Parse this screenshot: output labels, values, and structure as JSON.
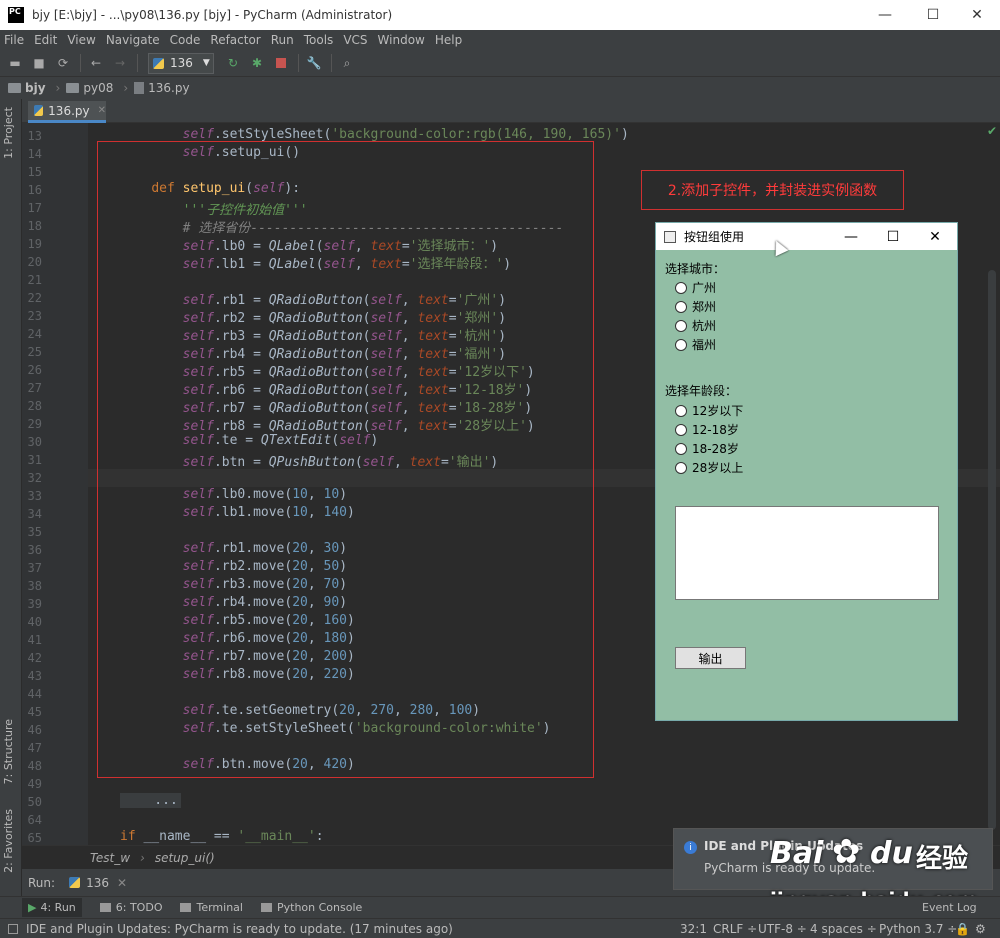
{
  "window": {
    "title": "bjy [E:\\bjy] - ...\\py08\\136.py [bjy] - PyCharm (Administrator)",
    "logo": "PC"
  },
  "menu": [
    "File",
    "Edit",
    "View",
    "Navigate",
    "Code",
    "Refactor",
    "Run",
    "Tools",
    "VCS",
    "Window",
    "Help"
  ],
  "toolbar": {
    "run_config": "136"
  },
  "nav": {
    "project": "bjy",
    "folder": "py08",
    "file": "136.py"
  },
  "left_tools": [
    "1: Project",
    "7: Structure",
    "2: Favorites"
  ],
  "tab": {
    "label": "136.py"
  },
  "code": [
    {
      "n": "13",
      "t": "        <s>self</s>.setStyleSheet(<g>'background-color:rgb(146, 190, 165)'</g>)"
    },
    {
      "n": "14",
      "t": "        <s>self</s>.setup_ui()"
    },
    {
      "n": "15",
      "t": ""
    },
    {
      "n": "16",
      "t": "    <k>def</k> <f>setup_ui</f>(<s>self</s>):"
    },
    {
      "n": "17",
      "t": "        <c>'''子控件初始值'''</c>"
    },
    {
      "n": "18",
      "t": "        <m># 选择省份----------------------------------------</m>"
    },
    {
      "n": "19",
      "t": "        <s>self</s>.lb0 = <i>QLabel</i>(<s>self</s>, <p>text</p>=<g>'选择城市：'</g>)"
    },
    {
      "n": "20",
      "t": "        <s>self</s>.lb1 = <i>QLabel</i>(<s>self</s>, <p>text</p>=<g>'选择年龄段：'</g>)"
    },
    {
      "n": "21",
      "t": ""
    },
    {
      "n": "22",
      "t": "        <s>self</s>.rb1 = <i>QRadioButton</i>(<s>self</s>, <p>text</p>=<g>'广州'</g>)"
    },
    {
      "n": "23",
      "t": "        <s>self</s>.rb2 = <i>QRadioButton</i>(<s>self</s>, <p>text</p>=<g>'郑州'</g>)"
    },
    {
      "n": "24",
      "t": "        <s>self</s>.rb3 = <i>QRadioButton</i>(<s>self</s>, <p>text</p>=<g>'杭州'</g>)"
    },
    {
      "n": "25",
      "t": "        <s>self</s>.rb4 = <i>QRadioButton</i>(<s>self</s>, <p>text</p>=<g>'福州'</g>)"
    },
    {
      "n": "26",
      "t": "        <s>self</s>.rb5 = <i>QRadioButton</i>(<s>self</s>, <p>text</p>=<g>'12岁以下'</g>)"
    },
    {
      "n": "27",
      "t": "        <s>self</s>.rb6 = <i>QRadioButton</i>(<s>self</s>, <p>text</p>=<g>'12-18岁'</g>)"
    },
    {
      "n": "28",
      "t": "        <s>self</s>.rb7 = <i>QRadioButton</i>(<s>self</s>, <p>text</p>=<g>'18-28岁'</g>)"
    },
    {
      "n": "29",
      "t": "        <s>self</s>.rb8 = <i>QRadioButton</i>(<s>self</s>, <p>text</p>=<g>'28岁以上'</g>)"
    },
    {
      "n": "30",
      "t": "        <s>self</s>.te = <i>QTextEdit</i>(<s>self</s>)"
    },
    {
      "n": "31",
      "t": "        <s>self</s>.btn = <i>QPushButton</i>(<s>self</s>, <p>text</p>=<g>'输出'</g>)"
    },
    {
      "n": "32",
      "t": ""
    },
    {
      "n": "33",
      "t": "        <s>self</s>.lb0.move(<u>10</u>, <u>10</u>)"
    },
    {
      "n": "34",
      "t": "        <s>self</s>.lb1.move(<u>10</u>, <u>140</u>)"
    },
    {
      "n": "35",
      "t": ""
    },
    {
      "n": "36",
      "t": "        <s>self</s>.rb1.move(<u>20</u>, <u>30</u>)"
    },
    {
      "n": "37",
      "t": "        <s>self</s>.rb2.move(<u>20</u>, <u>50</u>)"
    },
    {
      "n": "38",
      "t": "        <s>self</s>.rb3.move(<u>20</u>, <u>70</u>)"
    },
    {
      "n": "39",
      "t": "        <s>self</s>.rb4.move(<u>20</u>, <u>90</u>)"
    },
    {
      "n": "40",
      "t": "        <s>self</s>.rb5.move(<u>20</u>, <u>160</u>)"
    },
    {
      "n": "41",
      "t": "        <s>self</s>.rb6.move(<u>20</u>, <u>180</u>)"
    },
    {
      "n": "42",
      "t": "        <s>self</s>.rb7.move(<u>20</u>, <u>200</u>)"
    },
    {
      "n": "43",
      "t": "        <s>self</s>.rb8.move(<u>20</u>, <u>220</u>)"
    },
    {
      "n": "44",
      "t": ""
    },
    {
      "n": "45",
      "t": "        <s>self</s>.te.setGeometry(<u>20</u>, <u>270</u>, <u>280</u>, <u>100</u>)"
    },
    {
      "n": "46",
      "t": "        <s>self</s>.te.setStyleSheet(<g>'background-color:white'</g>)"
    },
    {
      "n": "47",
      "t": ""
    },
    {
      "n": "48",
      "t": "        <s>self</s>.btn.move(<u>20</u>, <u>420</u>)"
    },
    {
      "n": "49",
      "t": ""
    },
    {
      "n": "50",
      "t": "    ..."
    },
    {
      "n": "64",
      "t": ""
    },
    {
      "n": "65",
      "t": "<k>if</k> __name__ == <g>'__main__'</g>:"
    }
  ],
  "annotation": "2.添加子控件，并封装进实例函数",
  "qt_window": {
    "title": "按钮组使用",
    "label_city": "选择城市：",
    "cities": [
      "广州",
      "郑州",
      "杭州",
      "福州"
    ],
    "label_age": "选择年龄段：",
    "ages": [
      "12岁以下",
      "12-18岁",
      "18-28岁",
      "28岁以上"
    ],
    "button": "输出"
  },
  "breadcrumb": {
    "cls": "Test_w",
    "method": "setup_ui()"
  },
  "run": {
    "label": "Run:",
    "config": "136"
  },
  "bottom_tabs": [
    "4: Run",
    "6: TODO",
    "Terminal",
    "Python Console"
  ],
  "event_log": "Event Log",
  "status": {
    "message": "IDE and Plugin Updates: PyCharm is ready to update. (17 minutes ago)",
    "pos": "32:1",
    "crlf": "CRLF ÷",
    "enc": "UTF-8 ÷",
    "indent": "4 spaces ÷",
    "python": "Python 3.7 ÷"
  },
  "notification": {
    "title": "IDE and Plugin Updates",
    "body": "PyCharm is ready to update."
  },
  "watermark": {
    "brand": "Bai",
    "brand2": "du",
    "suffix": "经验",
    "url": "jingyan.baidu.com"
  }
}
